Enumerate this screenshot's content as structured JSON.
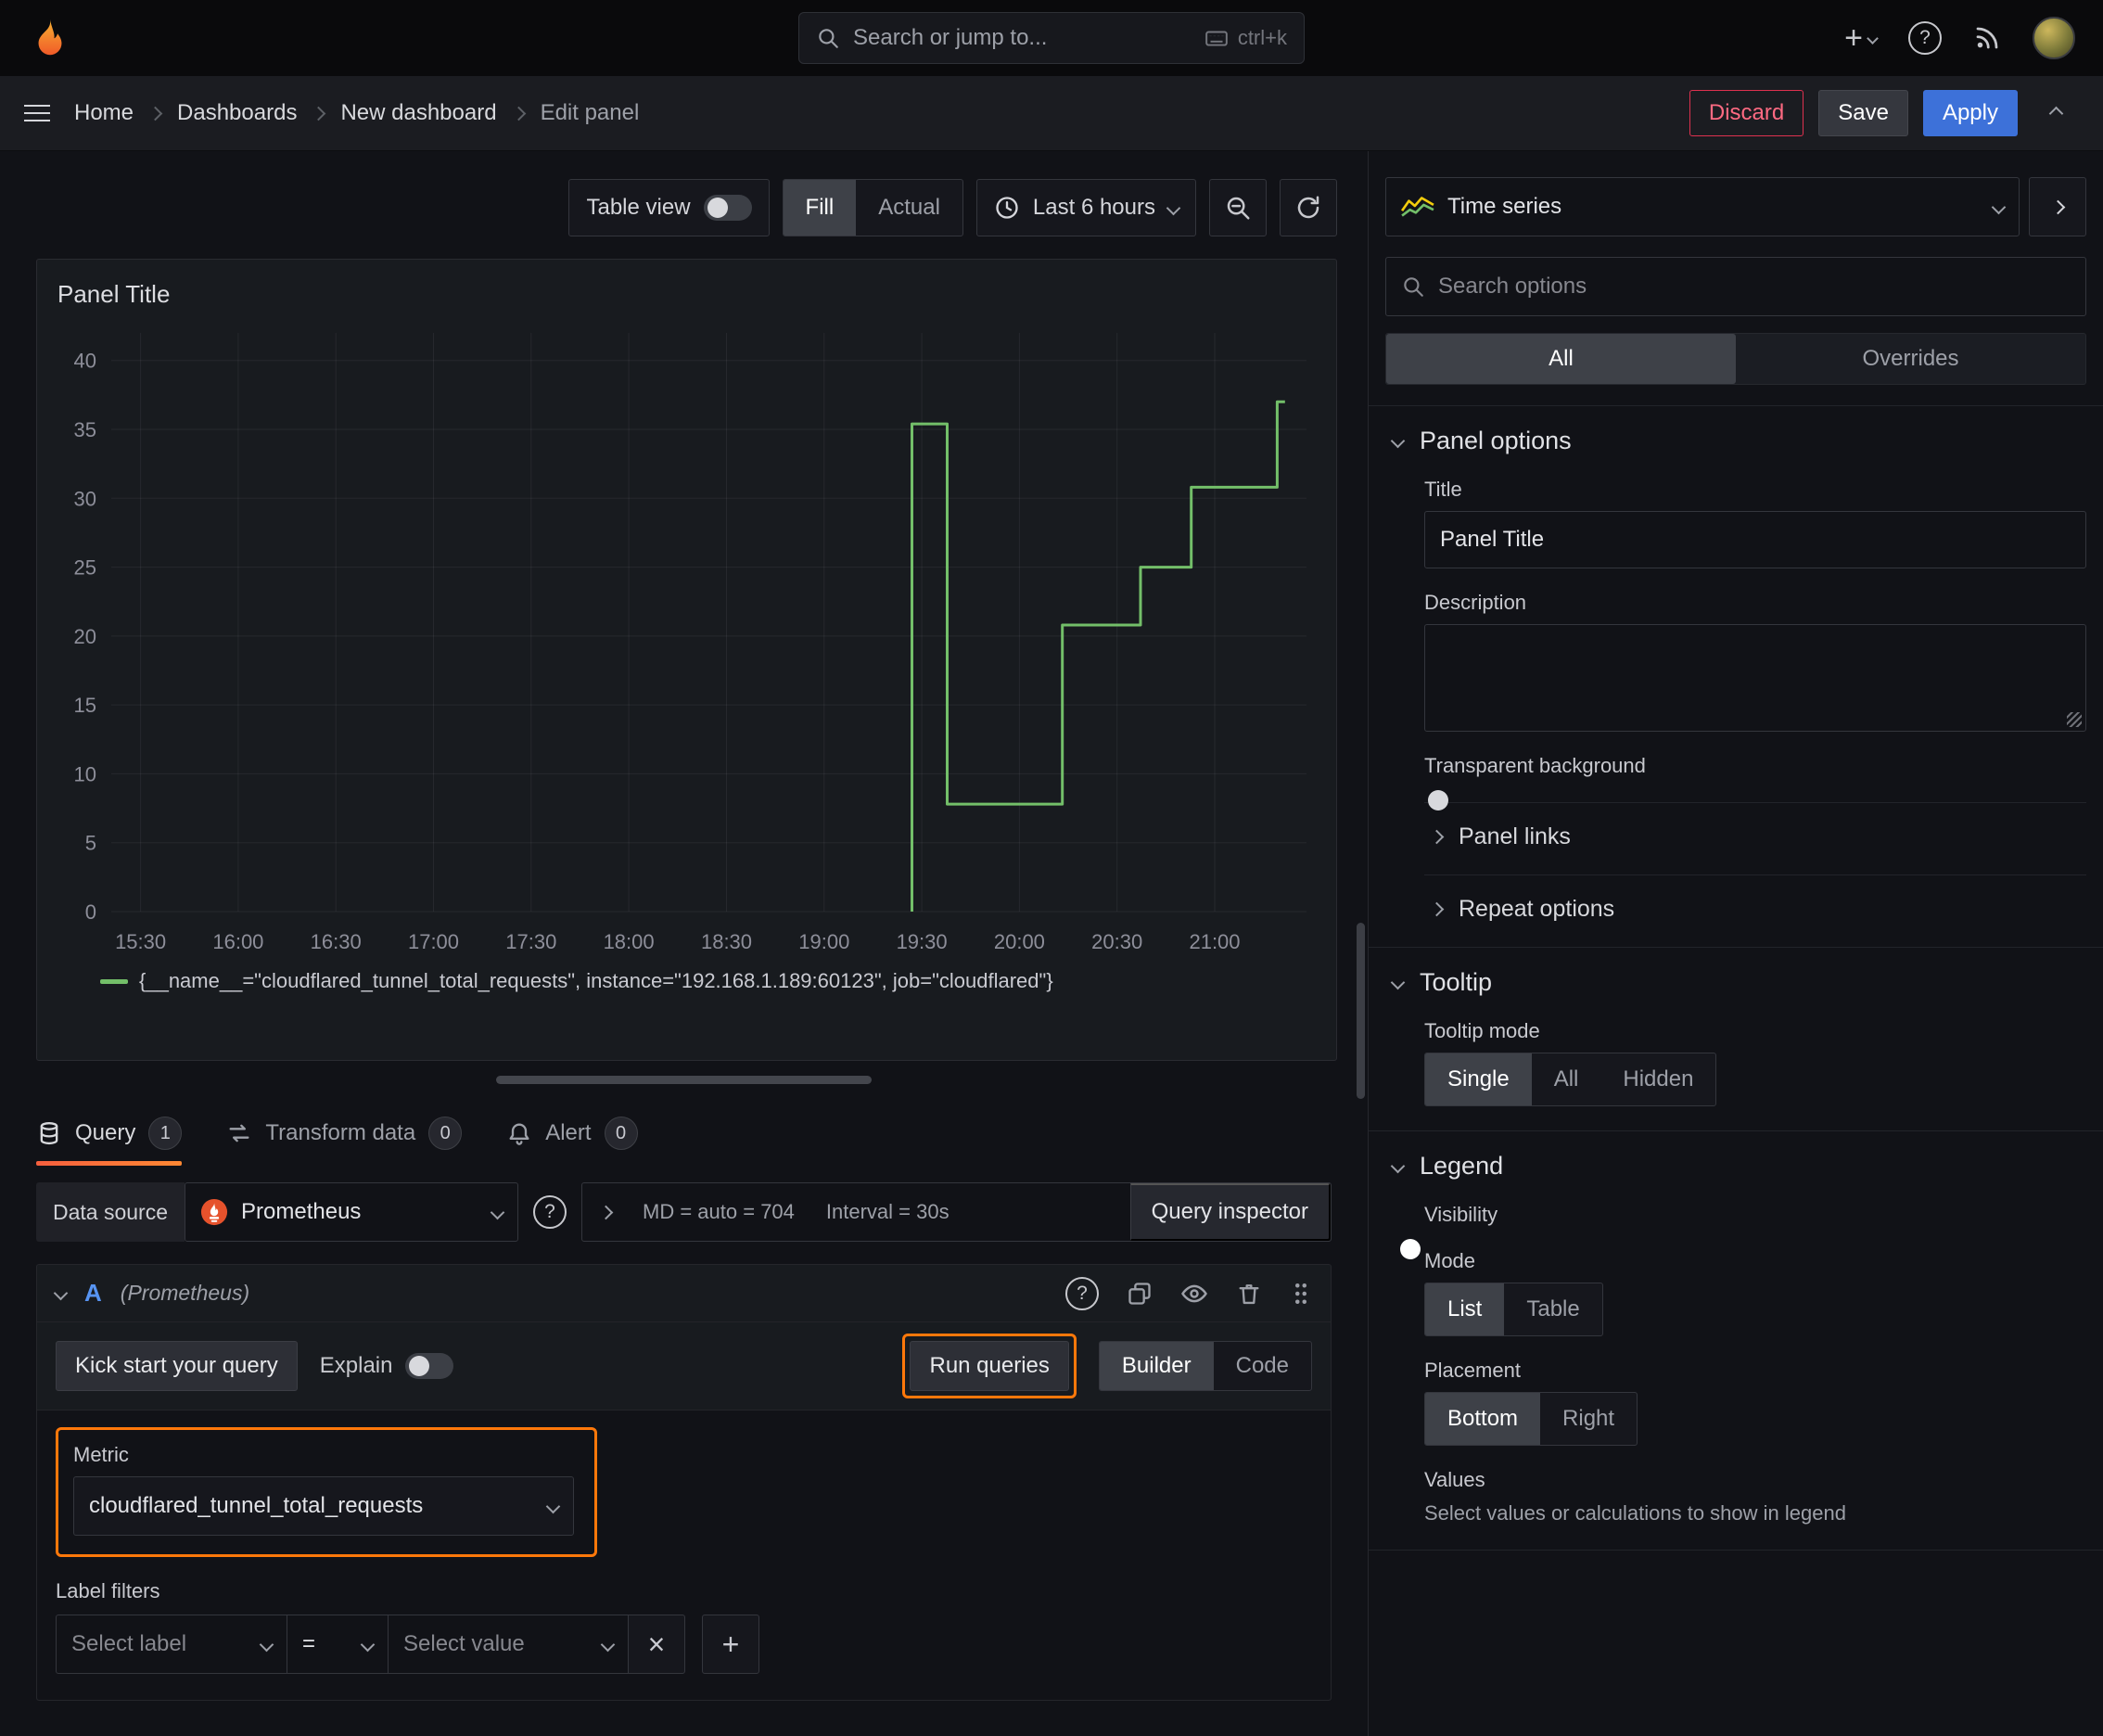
{
  "topnav": {
    "search_placeholder": "Search or jump to...",
    "shortcut": "ctrl+k"
  },
  "breadcrumb": {
    "items": [
      {
        "label": "Home"
      },
      {
        "label": "Dashboards"
      },
      {
        "label": "New dashboard"
      },
      {
        "label": "Edit panel"
      }
    ],
    "discard": "Discard",
    "save": "Save",
    "apply": "Apply"
  },
  "toolbar": {
    "table_view": "Table view",
    "fill": "Fill",
    "actual": "Actual",
    "time_range": "Last 6 hours"
  },
  "panel": {
    "title": "Panel Title",
    "legend_label": "{__name__=\"cloudflared_tunnel_total_requests\", instance=\"192.168.1.189:60123\", job=\"cloudflared\"}"
  },
  "chart_data": {
    "type": "line",
    "title": "Panel Title",
    "line_interpolation": "step",
    "xlim": [
      15.35,
      21.47
    ],
    "ylim": [
      0,
      42
    ],
    "yticks": [
      0,
      5,
      10,
      15,
      20,
      25,
      30,
      35,
      40
    ],
    "xticks": [
      {
        "x": 15.5,
        "label": "15:30"
      },
      {
        "x": 16.0,
        "label": "16:00"
      },
      {
        "x": 16.5,
        "label": "16:30"
      },
      {
        "x": 17.0,
        "label": "17:00"
      },
      {
        "x": 17.5,
        "label": "17:30"
      },
      {
        "x": 18.0,
        "label": "18:00"
      },
      {
        "x": 18.5,
        "label": "18:30"
      },
      {
        "x": 19.0,
        "label": "19:00"
      },
      {
        "x": 19.5,
        "label": "19:30"
      },
      {
        "x": 20.0,
        "label": "20:00"
      },
      {
        "x": 20.5,
        "label": "20:30"
      },
      {
        "x": 21.0,
        "label": "21:00"
      }
    ],
    "grid": true,
    "legend_position": "bottom",
    "series": [
      {
        "name": "{__name__=\"cloudflared_tunnel_total_requests\", instance=\"192.168.1.189:60123\", job=\"cloudflared\"}",
        "color": "#73bf69",
        "points": [
          {
            "x": 19.45,
            "y": 0
          },
          {
            "x": 19.45,
            "y": 35.4
          },
          {
            "x": 19.63,
            "y": 35.4
          },
          {
            "x": 19.63,
            "y": 7.8
          },
          {
            "x": 20.22,
            "y": 7.8
          },
          {
            "x": 20.22,
            "y": 20.8
          },
          {
            "x": 20.62,
            "y": 20.8
          },
          {
            "x": 20.62,
            "y": 25
          },
          {
            "x": 20.88,
            "y": 25
          },
          {
            "x": 20.88,
            "y": 30.8
          },
          {
            "x": 21.32,
            "y": 30.8
          },
          {
            "x": 21.32,
            "y": 37
          },
          {
            "x": 21.36,
            "y": 37
          }
        ]
      }
    ]
  },
  "query_section": {
    "tabs": [
      {
        "label": "Query",
        "badge": "1"
      },
      {
        "label": "Transform data",
        "badge": "0"
      },
      {
        "label": "Alert",
        "badge": "0"
      }
    ],
    "data_source_label": "Data source",
    "data_source_value": "Prometheus",
    "max_data_points": "MD = auto = 704",
    "interval": "Interval = 30s",
    "query_inspector": "Query inspector",
    "ref_id": "A",
    "ref_ds": "(Prometheus)",
    "kick_start": "Kick start your query",
    "explain": "Explain",
    "run_queries": "Run queries",
    "builder": "Builder",
    "code": "Code",
    "metric_label": "Metric",
    "metric_value": "cloudflared_tunnel_total_requests",
    "label_filters": "Label filters",
    "select_label": "Select label",
    "operator": "=",
    "select_value": "Select value"
  },
  "options": {
    "viz_type": "Time series",
    "search_placeholder": "Search options",
    "tab_all": "All",
    "tab_overrides": "Overrides",
    "panel_options": {
      "header": "Panel options",
      "title_label": "Title",
      "title_value": "Panel Title",
      "description_label": "Description",
      "transparent_label": "Transparent background",
      "panel_links": "Panel links",
      "repeat_options": "Repeat options"
    },
    "tooltip": {
      "header": "Tooltip",
      "mode_label": "Tooltip mode",
      "modes": [
        "Single",
        "All",
        "Hidden"
      ],
      "selected": "Single"
    },
    "legend": {
      "header": "Legend",
      "visibility_label": "Visibility",
      "mode_label": "Mode",
      "modes": [
        "List",
        "Table"
      ],
      "selected_mode": "List",
      "placement_label": "Placement",
      "placements": [
        "Bottom",
        "Right"
      ],
      "selected_placement": "Bottom",
      "values_label": "Values",
      "values_desc": "Select values or calculations to show in legend"
    }
  },
  "colors": {
    "accent_blue": "#3d71d9",
    "highlight_orange": "#ff780a",
    "series_green": "#73bf69",
    "destructive_red": "#de314f"
  }
}
